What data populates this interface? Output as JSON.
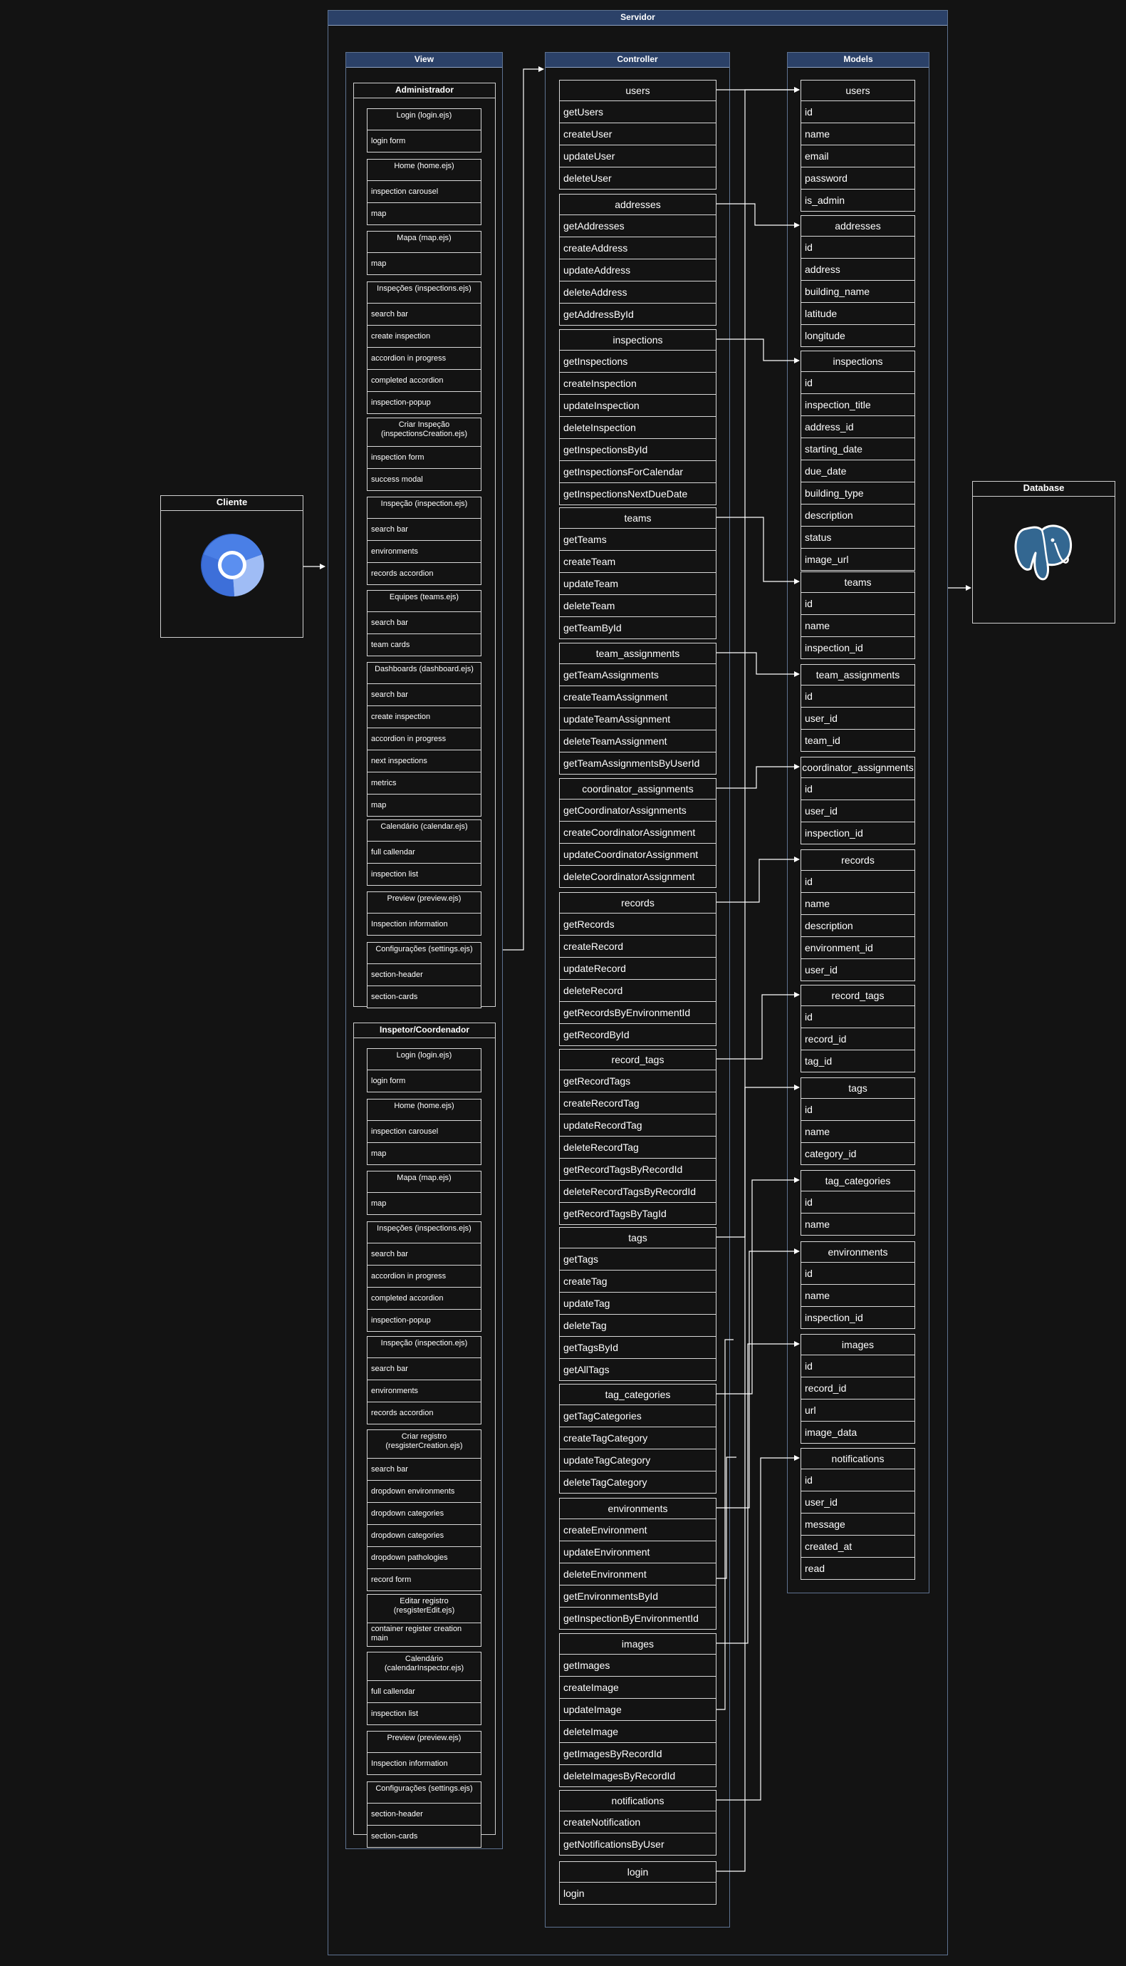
{
  "server": {
    "title": "Servidor"
  },
  "client": {
    "title": "Cliente",
    "icon": "chrome-browser-icon"
  },
  "database": {
    "title": "Database",
    "icon": "postgresql-elephant-icon"
  },
  "view": {
    "title": "View",
    "groups": [
      {
        "title": "Administrador",
        "cards": [
          {
            "title": "Login (login.ejs)",
            "items": [
              "login form"
            ]
          },
          {
            "title": "Home (home.ejs)",
            "items": [
              "inspection carousel",
              "map"
            ]
          },
          {
            "title": "Mapa (map.ejs)",
            "items": [
              "map"
            ]
          },
          {
            "title": "Inspeções (inspections.ejs)",
            "items": [
              "search bar",
              "create inspection",
              "accordion in progress",
              "completed accordion",
              "inspection-popup"
            ]
          },
          {
            "title": "Criar Inspeção (inspectionsCreation.ejs)",
            "items": [
              "inspection form",
              "success modal"
            ]
          },
          {
            "title": "Inspeção (inspection.ejs)",
            "items": [
              "search bar",
              "environments",
              "records accordion"
            ]
          },
          {
            "title": "Equipes (teams.ejs)",
            "items": [
              "search bar",
              "team cards"
            ]
          },
          {
            "title": "Dashboards (dashboard.ejs)",
            "items": [
              "search bar",
              "create inspection",
              "accordion in progress",
              "next inspections",
              "metrics",
              "map"
            ]
          },
          {
            "title": "Calendário (calendar.ejs)",
            "items": [
              "full callendar",
              "inspection list"
            ]
          },
          {
            "title": "Preview (preview.ejs)",
            "items": [
              "Inspection information"
            ]
          },
          {
            "title": "Configurações (settings.ejs)",
            "items": [
              "section-header",
              "section-cards"
            ]
          }
        ]
      },
      {
        "title": "Inspetor/Coordenador",
        "cards": [
          {
            "title": "Login (login.ejs)",
            "items": [
              "login form"
            ]
          },
          {
            "title": "Home (home.ejs)",
            "items": [
              "inspection carousel",
              "map"
            ]
          },
          {
            "title": "Mapa (map.ejs)",
            "items": [
              "map"
            ]
          },
          {
            "title": "Inspeções (inspections.ejs)",
            "items": [
              "search bar",
              "accordion in progress",
              "completed accordion",
              "inspection-popup"
            ]
          },
          {
            "title": "Inspeção (inspection.ejs)",
            "items": [
              "search bar",
              "environments",
              "records accordion"
            ]
          },
          {
            "title": "Criar registro (resgisterCreation.ejs)",
            "items": [
              "search bar",
              "dropdown environments",
              "dropdown categories",
              "dropdown categories",
              "dropdown pathologies",
              "record form"
            ]
          },
          {
            "title": "Editar registro (resgisterEdit.ejs)",
            "items": [
              "container register creation main"
            ]
          },
          {
            "title": "Calendário (calendarInspector.ejs)",
            "items": [
              "full callendar",
              "inspection list"
            ]
          },
          {
            "title": "Preview (preview.ejs)",
            "items": [
              "Inspection information"
            ]
          },
          {
            "title": "Configurações (settings.ejs)",
            "items": [
              "section-header",
              "section-cards"
            ]
          }
        ]
      }
    ]
  },
  "controller": {
    "title": "Controller",
    "cards": [
      {
        "title": "users",
        "items": [
          "getUsers",
          "createUser",
          "updateUser",
          "deleteUser"
        ]
      },
      {
        "title": "addresses",
        "items": [
          "getAddresses",
          "createAddress",
          "updateAddress",
          "deleteAddress",
          "getAddressById"
        ]
      },
      {
        "title": "inspections",
        "items": [
          "getInspections",
          "createInspection",
          "updateInspection",
          "deleteInspection",
          "getInspectionsById",
          "getInspectionsForCalendar",
          "getInspectionsNextDueDate"
        ]
      },
      {
        "title": "teams",
        "items": [
          "getTeams",
          "createTeam",
          "updateTeam",
          "deleteTeam",
          "getTeamById"
        ]
      },
      {
        "title": "team_assignments",
        "items": [
          "getTeamAssignments",
          "createTeamAssignment",
          "updateTeamAssignment",
          "deleteTeamAssignment",
          "getTeamAssignmentsByUserId"
        ]
      },
      {
        "title": "coordinator_assignments",
        "items": [
          "getCoordinatorAssignments",
          "createCoordinatorAssignment",
          "updateCoordinatorAssignment",
          "deleteCoordinatorAssignment"
        ]
      },
      {
        "title": "records",
        "items": [
          "getRecords",
          "createRecord",
          "updateRecord",
          "deleteRecord",
          "getRecordsByEnvironmentId",
          "getRecordById"
        ]
      },
      {
        "title": "record_tags",
        "items": [
          "getRecordTags",
          "createRecordTag",
          "updateRecordTag",
          "deleteRecordTag",
          "getRecordTagsByRecordId",
          "deleteRecordTagsByRecordId",
          "getRecordTagsByTagId"
        ]
      },
      {
        "title": "tags",
        "items": [
          "getTags",
          "createTag",
          "updateTag",
          "deleteTag",
          "getTagsById",
          "getAllTags"
        ]
      },
      {
        "title": "tag_categories",
        "items": [
          "getTagCategories",
          "createTagCategory",
          "updateTagCategory",
          "deleteTagCategory"
        ]
      },
      {
        "title": "environments",
        "items": [
          "createEnvironment",
          "updateEnvironment",
          "deleteEnvironment",
          "getEnvironmentsById",
          "getInspectionByEnvironmentId"
        ]
      },
      {
        "title": "images",
        "items": [
          "getImages",
          "createImage",
          "updateImage",
          "deleteImage",
          "getImagesByRecordId",
          "deleteImagesByRecordId"
        ]
      },
      {
        "title": "notifications",
        "items": [
          "createNotification",
          "getNotificationsByUser"
        ]
      },
      {
        "title": "login",
        "items": [
          "login"
        ]
      }
    ]
  },
  "models": {
    "title": "Models",
    "cards": [
      {
        "title": "users",
        "items": [
          "id",
          "name",
          "email",
          "password",
          "is_admin"
        ]
      },
      {
        "title": "addresses",
        "items": [
          "id",
          "address",
          "building_name",
          "latitude",
          "longitude"
        ]
      },
      {
        "title": "inspections",
        "items": [
          "id",
          "inspection_title",
          "address_id",
          "starting_date",
          "due_date",
          "building_type",
          "description",
          "status",
          "image_url"
        ]
      },
      {
        "title": "teams",
        "items": [
          "id",
          "name",
          "inspection_id"
        ]
      },
      {
        "title": "team_assignments",
        "items": [
          "id",
          "user_id",
          "team_id"
        ]
      },
      {
        "title": "coordinator_assignments",
        "items": [
          "id",
          "user_id",
          "inspection_id"
        ]
      },
      {
        "title": "records",
        "items": [
          "id",
          "name",
          "description",
          "environment_id",
          "user_id"
        ]
      },
      {
        "title": "record_tags",
        "items": [
          "id",
          "record_id",
          "tag_id"
        ]
      },
      {
        "title": "tags",
        "items": [
          "id",
          "name",
          "category_id"
        ]
      },
      {
        "title": "tag_categories",
        "items": [
          "id",
          "name"
        ]
      },
      {
        "title": "environments",
        "items": [
          "id",
          "name",
          "inspection_id"
        ]
      },
      {
        "title": "images",
        "items": [
          "id",
          "record_id",
          "url",
          "image_data"
        ]
      },
      {
        "title": "notifications",
        "items": [
          "id",
          "user_id",
          "message",
          "created_at",
          "read"
        ]
      }
    ]
  },
  "colors": {
    "background": "#131313",
    "header": "#2b4168",
    "frame": "#5e7290",
    "line": "#ffffff"
  }
}
